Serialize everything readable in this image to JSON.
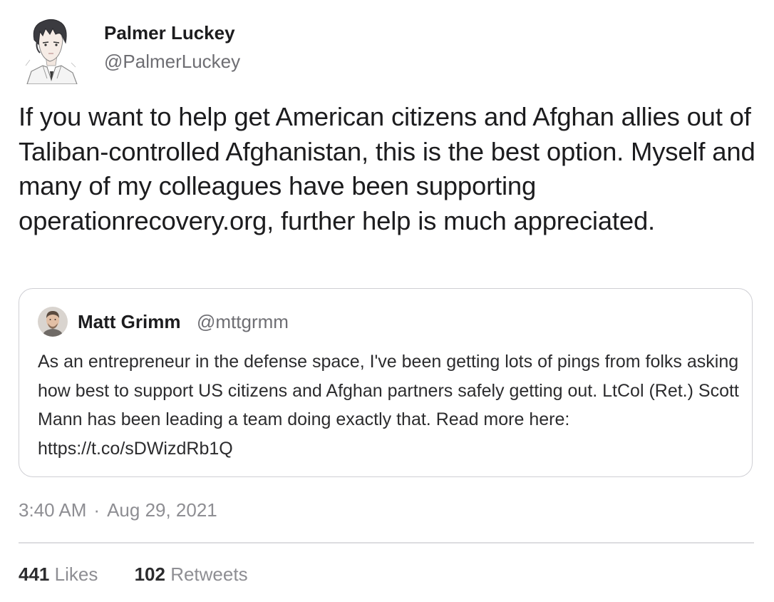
{
  "tweet": {
    "author": {
      "name": "Palmer Luckey",
      "handle": "@PalmerLuckey",
      "avatar_icon": "anime-portrait-avatar-icon"
    },
    "text": "If you want to help get American citizens and Afghan allies out of Taliban-controlled Afghanistan, this is the best option. Myself and many of my colleagues have been supporting operationrecovery.org, further help is much appreciated.",
    "quoted": {
      "name": "Matt Grimm",
      "handle": "@mttgrmm",
      "avatar_icon": "profile-photo-avatar-icon",
      "text": "As an entrepreneur in the defense space, I've been getting lots of pings from folks asking how best to support US citizens and Afghan partners safely getting out. LtCol (Ret.) Scott Mann has been leading a team doing exactly that. Read more here: https://t.co/sDWizdRb1Q"
    },
    "time": "3:40 AM",
    "separator": "·",
    "date": "Aug 29, 2021",
    "stats": {
      "likes_count": "441",
      "likes_label": "Likes",
      "retweets_count": "102",
      "retweets_label": "Retweets"
    }
  },
  "colors": {
    "text": "#1c1c1e",
    "secondary": "#6e6e73",
    "meta": "#8e8e93",
    "border": "#cfcfd4",
    "divider": "#dcdce0"
  }
}
